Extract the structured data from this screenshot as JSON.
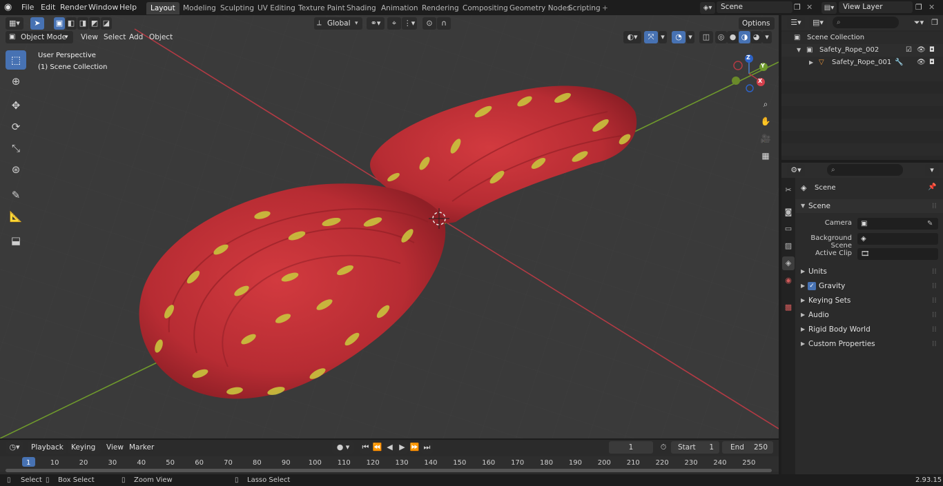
{
  "menu": [
    "File",
    "Edit",
    "Render",
    "Window",
    "Help"
  ],
  "workspaces": [
    "Layout",
    "Modeling",
    "Sculpting",
    "UV Editing",
    "Texture Paint",
    "Shading",
    "Animation",
    "Rendering",
    "Compositing",
    "Geometry Nodes",
    "Scripting"
  ],
  "active_workspace": "Layout",
  "add_tab": "+",
  "scene_name": "Scene",
  "view_layer": "View Layer",
  "viewport": {
    "mode": "Object Mode",
    "header_menu": [
      "View",
      "Select",
      "Add",
      "Object"
    ],
    "orientation": "Global",
    "options": "Options",
    "overlay_title": "User Perspective",
    "overlay_collection": "(1) Scene Collection",
    "gizmo_labels": {
      "x": "X",
      "y": "Y",
      "z": "Z"
    }
  },
  "outliner": {
    "rows": [
      {
        "label": "Scene Collection"
      },
      {
        "label": "Safety_Rope_002"
      },
      {
        "label": "Safety_Rope_001"
      }
    ]
  },
  "properties": {
    "context": "Scene",
    "panel_title": "Scene",
    "fields": [
      {
        "label": "Camera",
        "value": ""
      },
      {
        "label": "Background Scene",
        "value": ""
      },
      {
        "label": "Active Clip",
        "value": ""
      }
    ],
    "panels": [
      "Units",
      "Gravity",
      "Keying Sets",
      "Audio",
      "Rigid Body World",
      "Custom Properties"
    ],
    "gravity_checked": true
  },
  "timeline": {
    "menu": [
      "Playback",
      "Keying",
      "View",
      "Marker"
    ],
    "current_frame": "1",
    "start_label": "Start",
    "start": "1",
    "end_label": "End",
    "end": "250",
    "ticks": [
      "1",
      "10",
      "20",
      "30",
      "40",
      "50",
      "60",
      "70",
      "80",
      "90",
      "100",
      "110",
      "120",
      "130",
      "140",
      "150",
      "160",
      "170",
      "180",
      "190",
      "200",
      "210",
      "220",
      "230",
      "240",
      "250"
    ]
  },
  "status": {
    "select": "Select",
    "box_select": "Box Select",
    "zoom_view": "Zoom View",
    "lasso_select": "Lasso Select",
    "version": "2.93.15"
  },
  "colors": {
    "accent": "#4772b3",
    "rope_red": "#c8323a",
    "rope_yellow": "#c9c43e",
    "axis_x": "#b23a44",
    "axis_y": "#6f9a2c"
  }
}
